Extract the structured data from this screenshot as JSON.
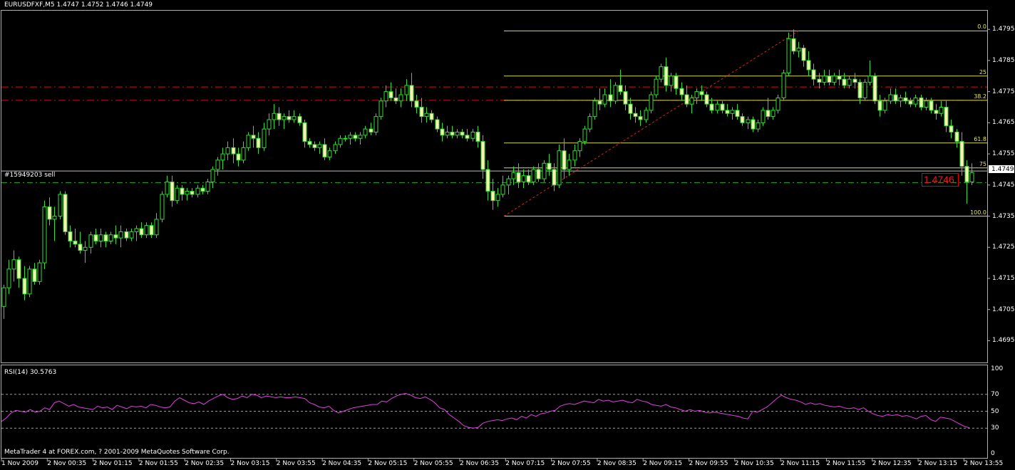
{
  "header": {
    "symbol_line": "EURUSDFXF,M5  1.4747 1.4752 1.4746 1.4749"
  },
  "order_label": "#15949203 sell",
  "price_axis": {
    "labels": [
      "1.4795",
      "1.4785",
      "1.4775",
      "1.4765",
      "1.4755",
      "1.4745",
      "1.4735",
      "1.4725",
      "1.4715",
      "1.4705",
      "1.4695"
    ],
    "current_price": "1.4749"
  },
  "price_box": "1.4746",
  "fibonacci": {
    "levels": [
      "0.0",
      "25",
      "38.2",
      "61.8",
      "75",
      "100.0"
    ]
  },
  "rsi": {
    "title": "RSI(14) 30.5763",
    "axis_labels": [
      "100",
      "70",
      "50",
      "30",
      "0"
    ]
  },
  "footer": {
    "copyright": "MetaTrader 4 at FOREX.com, ? 2001-2009 MetaQuotes Software Corp."
  },
  "time_axis": {
    "labels": [
      "1 Nov 2009",
      "2 Nov 00:35",
      "2 Nov 01:15",
      "2 Nov 01:55",
      "2 Nov 02:35",
      "2 Nov 03:15",
      "2 Nov 03:55",
      "2 Nov 04:35",
      "2 Nov 05:15",
      "2 Nov 05:55",
      "2 Nov 06:35",
      "2 Nov 07:15",
      "2 Nov 07:55",
      "2 Nov 08:35",
      "2 Nov 09:15",
      "2 Nov 09:55",
      "2 Nov 10:35",
      "2 Nov 11:15",
      "2 Nov 11:55",
      "2 Nov 12:35",
      "2 Nov 13:15",
      "2 Nov 13:55"
    ]
  },
  "chart_data": {
    "type": "candlestick",
    "symbol": "EURUSDFXF",
    "timeframe": "M5",
    "ylim": [
      1.4688,
      1.4801
    ],
    "candles": [
      [
        1.4706,
        1.4713,
        1.4702,
        1.4712
      ],
      [
        1.4712,
        1.4721,
        1.471,
        1.4718
      ],
      [
        1.4718,
        1.4724,
        1.4714,
        1.4721
      ],
      [
        1.4721,
        1.4722,
        1.4712,
        1.4715
      ],
      [
        1.4715,
        1.4719,
        1.4708,
        1.471
      ],
      [
        1.471,
        1.4719,
        1.4709,
        1.4718
      ],
      [
        1.4718,
        1.472,
        1.4713,
        1.4714
      ],
      [
        1.4714,
        1.4721,
        1.4713,
        1.472
      ],
      [
        1.472,
        1.474,
        1.4718,
        1.4738
      ],
      [
        1.4738,
        1.4741,
        1.4732,
        1.4734
      ],
      [
        1.4734,
        1.4738,
        1.4727,
        1.4735
      ],
      [
        1.4735,
        1.4743,
        1.4734,
        1.4742
      ],
      [
        1.4742,
        1.4743,
        1.4729,
        1.473
      ],
      [
        1.473,
        1.4732,
        1.4725,
        1.4727
      ],
      [
        1.4727,
        1.4731,
        1.4725,
        1.4726
      ],
      [
        1.4726,
        1.473,
        1.4723,
        1.4724
      ],
      [
        1.4724,
        1.4727,
        1.472,
        1.4725
      ],
      [
        1.4725,
        1.473,
        1.4723,
        1.4729
      ],
      [
        1.4729,
        1.4731,
        1.4726,
        1.4727
      ],
      [
        1.4727,
        1.4731,
        1.4725,
        1.4729
      ],
      [
        1.4729,
        1.473,
        1.4725,
        1.4727
      ],
      [
        1.4727,
        1.473,
        1.4726,
        1.4729
      ],
      [
        1.4729,
        1.4732,
        1.4726,
        1.4728
      ],
      [
        1.4728,
        1.4732,
        1.4725,
        1.473
      ],
      [
        1.473,
        1.4731,
        1.4727,
        1.4728
      ],
      [
        1.4728,
        1.4731,
        1.4727,
        1.473
      ],
      [
        1.473,
        1.4732,
        1.4727,
        1.4731
      ],
      [
        1.4731,
        1.4733,
        1.4728,
        1.4729
      ],
      [
        1.4729,
        1.4733,
        1.4728,
        1.4732
      ],
      [
        1.4732,
        1.4733,
        1.4728,
        1.4729
      ],
      [
        1.4729,
        1.4736,
        1.4728,
        1.4734
      ],
      [
        1.4734,
        1.4743,
        1.4733,
        1.4742
      ],
      [
        1.4742,
        1.4748,
        1.4741,
        1.4746
      ],
      [
        1.4746,
        1.4748,
        1.4738,
        1.474
      ],
      [
        1.474,
        1.4745,
        1.4739,
        1.4744
      ],
      [
        1.4744,
        1.4745,
        1.474,
        1.4742
      ],
      [
        1.4742,
        1.4744,
        1.474,
        1.4743
      ],
      [
        1.4743,
        1.4744,
        1.4741,
        1.4742
      ],
      [
        1.4742,
        1.4745,
        1.4741,
        1.4744
      ],
      [
        1.4744,
        1.4745,
        1.4742,
        1.4743
      ],
      [
        1.4743,
        1.4747,
        1.4742,
        1.4746
      ],
      [
        1.4746,
        1.4751,
        1.4744,
        1.475
      ],
      [
        1.475,
        1.4754,
        1.4748,
        1.4753
      ],
      [
        1.4753,
        1.4757,
        1.475,
        1.4755
      ],
      [
        1.4755,
        1.4759,
        1.4753,
        1.4757
      ],
      [
        1.4757,
        1.476,
        1.4752,
        1.4755
      ],
      [
        1.4755,
        1.4757,
        1.4751,
        1.4753
      ],
      [
        1.4753,
        1.4759,
        1.4752,
        1.4757
      ],
      [
        1.4757,
        1.4762,
        1.4756,
        1.4761
      ],
      [
        1.4761,
        1.4764,
        1.4757,
        1.476
      ],
      [
        1.476,
        1.4762,
        1.4755,
        1.4757
      ],
      [
        1.4757,
        1.4765,
        1.4756,
        1.4763
      ],
      [
        1.4763,
        1.4768,
        1.4761,
        1.4766
      ],
      [
        1.4766,
        1.4771,
        1.4763,
        1.4768
      ],
      [
        1.4768,
        1.477,
        1.4764,
        1.4766
      ],
      [
        1.4766,
        1.4768,
        1.4763,
        1.4767
      ],
      [
        1.4767,
        1.4769,
        1.4765,
        1.4766
      ],
      [
        1.4766,
        1.4769,
        1.4765,
        1.4767
      ],
      [
        1.4767,
        1.4768,
        1.4764,
        1.4765
      ],
      [
        1.4765,
        1.4766,
        1.4757,
        1.4759
      ],
      [
        1.4759,
        1.476,
        1.4757,
        1.4758
      ],
      [
        1.4758,
        1.4759,
        1.4756,
        1.4757
      ],
      [
        1.4757,
        1.4759,
        1.4755,
        1.4758
      ],
      [
        1.4758,
        1.476,
        1.4753,
        1.4754
      ],
      [
        1.4754,
        1.4757,
        1.4753,
        1.4756
      ],
      [
        1.4756,
        1.4759,
        1.4755,
        1.4758
      ],
      [
        1.4758,
        1.4761,
        1.4757,
        1.476
      ],
      [
        1.476,
        1.4761,
        1.4759,
        1.476
      ],
      [
        1.476,
        1.4762,
        1.4758,
        1.4761
      ],
      [
        1.4761,
        1.4762,
        1.4759,
        1.476
      ],
      [
        1.476,
        1.4762,
        1.4758,
        1.4761
      ],
      [
        1.4761,
        1.4764,
        1.476,
        1.4763
      ],
      [
        1.4763,
        1.4765,
        1.4761,
        1.4762
      ],
      [
        1.4762,
        1.4768,
        1.4761,
        1.4767
      ],
      [
        1.4767,
        1.4773,
        1.4766,
        1.4772
      ],
      [
        1.4772,
        1.4777,
        1.477,
        1.4775
      ],
      [
        1.4775,
        1.4778,
        1.4772,
        1.4773
      ],
      [
        1.4773,
        1.4776,
        1.4771,
        1.4772
      ],
      [
        1.4772,
        1.4776,
        1.477,
        1.4774
      ],
      [
        1.4774,
        1.4779,
        1.4772,
        1.4777
      ],
      [
        1.4777,
        1.4781,
        1.477,
        1.4772
      ],
      [
        1.4772,
        1.4774,
        1.4768,
        1.477
      ],
      [
        1.477,
        1.4773,
        1.4765,
        1.4767
      ],
      [
        1.4767,
        1.477,
        1.4765,
        1.4768
      ],
      [
        1.4768,
        1.4769,
        1.4765,
        1.4766
      ],
      [
        1.4766,
        1.4767,
        1.4762,
        1.4763
      ],
      [
        1.4763,
        1.4765,
        1.4759,
        1.4761
      ],
      [
        1.4761,
        1.4764,
        1.476,
        1.4762
      ],
      [
        1.4762,
        1.4764,
        1.476,
        1.4761
      ],
      [
        1.4761,
        1.4763,
        1.476,
        1.4762
      ],
      [
        1.4762,
        1.4763,
        1.476,
        1.4761
      ],
      [
        1.4761,
        1.4763,
        1.4759,
        1.476
      ],
      [
        1.476,
        1.4763,
        1.4759,
        1.4762
      ],
      [
        1.4762,
        1.4764,
        1.4757,
        1.4759
      ],
      [
        1.4759,
        1.4761,
        1.4747,
        1.475
      ],
      [
        1.475,
        1.4753,
        1.474,
        1.4743
      ],
      [
        1.4743,
        1.4747,
        1.4737,
        1.474
      ],
      [
        1.474,
        1.4744,
        1.4738,
        1.4742
      ],
      [
        1.4742,
        1.4748,
        1.4741,
        1.4745
      ],
      [
        1.4745,
        1.4748,
        1.4742,
        1.4747
      ],
      [
        1.4747,
        1.4751,
        1.4745,
        1.4749
      ],
      [
        1.4749,
        1.4752,
        1.4744,
        1.4746
      ],
      [
        1.4746,
        1.475,
        1.4744,
        1.4748
      ],
      [
        1.4748,
        1.475,
        1.4745,
        1.4746
      ],
      [
        1.4746,
        1.4751,
        1.4745,
        1.475
      ],
      [
        1.475,
        1.4752,
        1.4746,
        1.4747
      ],
      [
        1.4747,
        1.4753,
        1.4746,
        1.4752
      ],
      [
        1.4752,
        1.4755,
        1.4748,
        1.475
      ],
      [
        1.475,
        1.4752,
        1.4743,
        1.4745
      ],
      [
        1.4745,
        1.4758,
        1.4744,
        1.4756
      ],
      [
        1.4756,
        1.476,
        1.4747,
        1.475
      ],
      [
        1.475,
        1.4755,
        1.4748,
        1.4753
      ],
      [
        1.4753,
        1.4758,
        1.4751,
        1.4756
      ],
      [
        1.4756,
        1.476,
        1.4754,
        1.4759
      ],
      [
        1.4759,
        1.4764,
        1.4758,
        1.4763
      ],
      [
        1.4763,
        1.4768,
        1.4762,
        1.4767
      ],
      [
        1.4767,
        1.4773,
        1.4766,
        1.4772
      ],
      [
        1.4772,
        1.4776,
        1.4769,
        1.4771
      ],
      [
        1.4771,
        1.4776,
        1.477,
        1.4774
      ],
      [
        1.4774,
        1.4779,
        1.477,
        1.4772
      ],
      [
        1.4772,
        1.4778,
        1.4771,
        1.4777
      ],
      [
        1.4777,
        1.4782,
        1.4774,
        1.4775
      ],
      [
        1.4775,
        1.4777,
        1.4769,
        1.4771
      ],
      [
        1.4771,
        1.4773,
        1.4766,
        1.4768
      ],
      [
        1.4768,
        1.477,
        1.4765,
        1.4767
      ],
      [
        1.4767,
        1.4769,
        1.4764,
        1.4766
      ],
      [
        1.4766,
        1.477,
        1.4765,
        1.4769
      ],
      [
        1.4769,
        1.4775,
        1.4768,
        1.4774
      ],
      [
        1.4774,
        1.478,
        1.4773,
        1.4779
      ],
      [
        1.4779,
        1.4784,
        1.4778,
        1.4783
      ],
      [
        1.4783,
        1.4786,
        1.4775,
        1.4777
      ],
      [
        1.4777,
        1.4781,
        1.4775,
        1.478
      ],
      [
        1.478,
        1.4781,
        1.4774,
        1.4776
      ],
      [
        1.4776,
        1.4778,
        1.4772,
        1.4774
      ],
      [
        1.4774,
        1.4777,
        1.477,
        1.4771
      ],
      [
        1.4771,
        1.4774,
        1.4768,
        1.4773
      ],
      [
        1.4773,
        1.4776,
        1.4771,
        1.4775
      ],
      [
        1.4775,
        1.4777,
        1.4772,
        1.4774
      ],
      [
        1.4774,
        1.4775,
        1.477,
        1.4771
      ],
      [
        1.4771,
        1.4773,
        1.4768,
        1.4769
      ],
      [
        1.4769,
        1.4772,
        1.4768,
        1.4771
      ],
      [
        1.4771,
        1.4772,
        1.4768,
        1.4769
      ],
      [
        1.4769,
        1.4771,
        1.4767,
        1.4768
      ],
      [
        1.4768,
        1.477,
        1.4766,
        1.4769
      ],
      [
        1.4769,
        1.4771,
        1.4766,
        1.4767
      ],
      [
        1.4767,
        1.4768,
        1.4764,
        1.4765
      ],
      [
        1.4765,
        1.4767,
        1.4763,
        1.4766
      ],
      [
        1.4766,
        1.4767,
        1.4762,
        1.4763
      ],
      [
        1.4763,
        1.4766,
        1.4762,
        1.4765
      ],
      [
        1.4765,
        1.477,
        1.4764,
        1.4769
      ],
      [
        1.4769,
        1.4773,
        1.4766,
        1.4767
      ],
      [
        1.4767,
        1.477,
        1.4766,
        1.4769
      ],
      [
        1.4769,
        1.4774,
        1.4768,
        1.4773
      ],
      [
        1.4773,
        1.4782,
        1.4772,
        1.4781
      ],
      [
        1.4781,
        1.4794,
        1.478,
        1.4792
      ],
      [
        1.4792,
        1.4795,
        1.4787,
        1.4788
      ],
      [
        1.4788,
        1.4791,
        1.4786,
        1.4789
      ],
      [
        1.4789,
        1.479,
        1.4783,
        1.4785
      ],
      [
        1.4785,
        1.4788,
        1.478,
        1.4782
      ],
      [
        1.4782,
        1.4784,
        1.4777,
        1.4779
      ],
      [
        1.4779,
        1.4781,
        1.4776,
        1.4778
      ],
      [
        1.4778,
        1.4782,
        1.4777,
        1.478
      ],
      [
        1.478,
        1.4782,
        1.4777,
        1.4778
      ],
      [
        1.4778,
        1.4781,
        1.4777,
        1.478
      ],
      [
        1.478,
        1.4782,
        1.4777,
        1.4779
      ],
      [
        1.4779,
        1.4781,
        1.4776,
        1.4777
      ],
      [
        1.4777,
        1.478,
        1.4776,
        1.4779
      ],
      [
        1.4779,
        1.4781,
        1.4776,
        1.4778
      ],
      [
        1.4778,
        1.4779,
        1.4771,
        1.4773
      ],
      [
        1.4773,
        1.4779,
        1.4772,
        1.4778
      ],
      [
        1.4778,
        1.4785,
        1.4777,
        1.478
      ],
      [
        1.478,
        1.4781,
        1.4771,
        1.4772
      ],
      [
        1.4772,
        1.4774,
        1.4767,
        1.4769
      ],
      [
        1.4769,
        1.4773,
        1.4768,
        1.4772
      ],
      [
        1.4772,
        1.4776,
        1.4771,
        1.4774
      ],
      [
        1.4774,
        1.4776,
        1.4771,
        1.4772
      ],
      [
        1.4772,
        1.4774,
        1.477,
        1.4773
      ],
      [
        1.4773,
        1.4775,
        1.4771,
        1.4772
      ],
      [
        1.4772,
        1.4773,
        1.477,
        1.4771
      ],
      [
        1.4771,
        1.4774,
        1.477,
        1.4773
      ],
      [
        1.4773,
        1.4774,
        1.4769,
        1.477
      ],
      [
        1.477,
        1.4773,
        1.4769,
        1.4772
      ],
      [
        1.4772,
        1.4773,
        1.4768,
        1.4769
      ],
      [
        1.4769,
        1.4771,
        1.4766,
        1.4768
      ],
      [
        1.4768,
        1.4772,
        1.4767,
        1.477
      ],
      [
        1.477,
        1.4772,
        1.4762,
        1.4764
      ],
      [
        1.4764,
        1.4766,
        1.476,
        1.4762
      ],
      [
        1.4762,
        1.4763,
        1.4757,
        1.4759
      ],
      [
        1.4759,
        1.4762,
        1.4748,
        1.4751
      ],
      [
        1.4751,
        1.4753,
        1.4739,
        1.4746
      ],
      [
        1.4746,
        1.4752,
        1.4745,
        1.4749
      ]
    ],
    "fib_levels": [
      {
        "label": "0.0",
        "price": 1.47945
      },
      {
        "label": "25",
        "price": 1.478
      },
      {
        "label": "38.2",
        "price": 1.47722
      },
      {
        "label": "61.8",
        "price": 1.47585
      },
      {
        "label": "75",
        "price": 1.47505
      },
      {
        "label": "100.0",
        "price": 1.4735
      }
    ],
    "horizontal_lines": {
      "red_dashed": [
        1.47765,
        1.47722
      ],
      "sell_order": 1.47495,
      "bid_dashdot": 1.47458
    },
    "rsi_values": [
      38,
      42,
      48,
      51,
      50,
      49,
      52,
      49,
      50,
      54,
      52,
      60,
      62,
      59,
      56,
      58,
      55,
      54,
      53,
      52,
      56,
      54,
      55,
      52,
      57,
      55,
      53,
      56,
      55,
      56,
      54,
      58,
      57,
      55,
      54,
      55,
      62,
      66,
      63,
      60,
      59,
      61,
      58,
      62,
      65,
      68,
      70,
      66,
      64,
      65,
      68,
      66,
      70,
      69,
      66,
      68,
      67,
      66,
      67,
      66,
      66,
      67,
      66,
      65,
      60,
      58,
      55,
      54,
      56,
      51,
      48,
      50,
      52,
      54,
      55,
      56,
      57,
      58,
      58,
      62,
      61,
      65,
      68,
      70,
      71,
      69,
      66,
      65,
      67,
      64,
      60,
      54,
      52,
      46,
      42,
      38,
      33,
      31,
      30,
      31,
      36,
      38,
      39,
      40,
      39,
      41,
      42,
      40,
      44,
      42,
      46,
      44,
      47,
      48,
      50,
      51,
      56,
      58,
      59,
      58,
      60,
      62,
      61,
      60,
      64,
      62,
      63,
      61,
      62,
      63,
      61,
      60,
      64,
      62,
      61,
      58,
      57,
      56,
      58,
      55,
      54,
      52,
      50,
      52,
      50,
      51,
      49,
      48,
      49,
      48,
      47,
      46,
      45,
      44,
      42,
      41,
      50,
      49,
      52,
      55,
      60,
      65,
      69,
      66,
      64,
      63,
      61,
      58,
      60,
      58,
      59,
      57,
      56,
      55,
      56,
      54,
      53,
      54,
      52,
      54,
      50,
      47,
      45,
      44,
      46,
      45,
      46,
      44,
      45,
      43,
      41,
      44,
      45,
      40,
      38,
      43,
      42,
      41,
      38,
      35,
      32,
      30.5763
    ],
    "rsi_levels": [
      70,
      50,
      30
    ],
    "rsi_ylim": [
      0,
      100
    ]
  }
}
